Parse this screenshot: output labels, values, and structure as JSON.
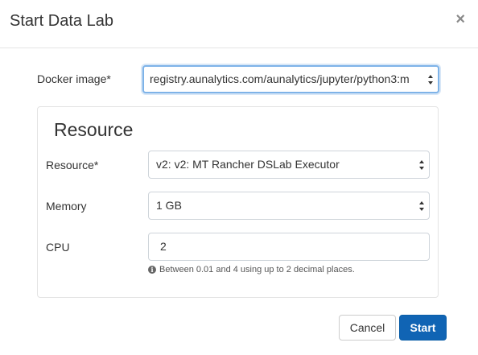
{
  "modal": {
    "title": "Start Data Lab",
    "close_icon": "close-icon",
    "close_glyph": "×"
  },
  "form": {
    "docker_image": {
      "label": "Docker image*",
      "value": "registry.aunalytics.com/aunalytics/jupyter/python3:m"
    },
    "resource_section": {
      "title": "Resource",
      "resource": {
        "label": "Resource*",
        "value": "v2: v2: MT Rancher DSLab Executor"
      },
      "memory": {
        "label": "Memory",
        "value": "1 GB"
      },
      "cpu": {
        "label": "CPU",
        "value": "2",
        "help_icon": "info-icon",
        "help": "Between 0.01 and 4 using up to 2 decimal places."
      }
    }
  },
  "footer": {
    "cancel_label": "Cancel",
    "start_label": "Start"
  },
  "colors": {
    "primary": "#1064b4",
    "focus_border": "#7eb3e8"
  }
}
